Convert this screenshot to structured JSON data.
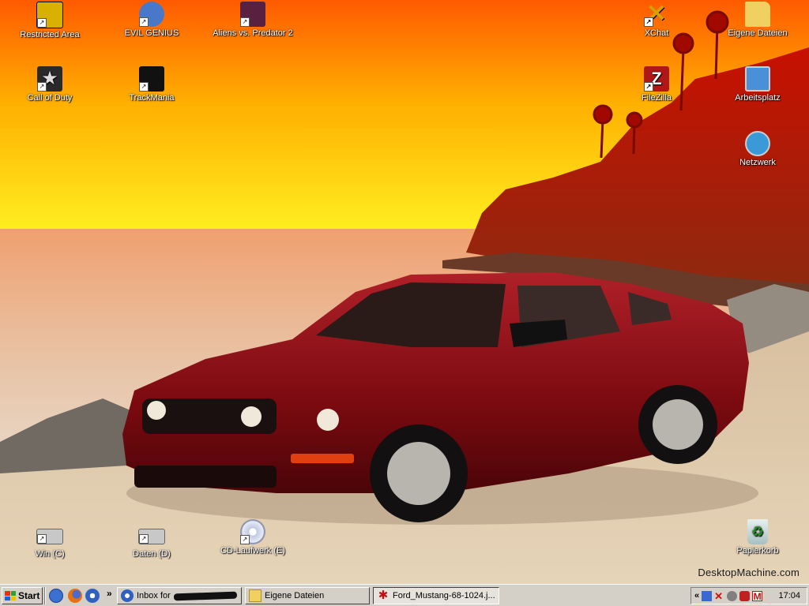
{
  "desktop": {
    "watermark": "DesktopMachine.com",
    "icons_left": [
      {
        "label": "Restricted Area",
        "icon": "restricted-area-icon",
        "color": "#d8b000"
      },
      {
        "label": "EVIL GENIUS",
        "icon": "evil-genius-icon",
        "color": "#4a78c8"
      },
      {
        "label": "Aliens vs. Predator 2",
        "icon": "avp2-icon",
        "color": "#5a2040"
      },
      {
        "label": "Call of Duty",
        "icon": "call-of-duty-icon",
        "color": "#2a2a2a"
      },
      {
        "label": "TrackMania",
        "icon": "trackmania-icon",
        "color": "#111111"
      }
    ],
    "icons_right": [
      {
        "label": "XChat",
        "icon": "xchat-icon",
        "color": "#d8a000"
      },
      {
        "label": "Eigene Dateien",
        "icon": "my-documents-icon",
        "color": "#f0d060"
      },
      {
        "label": "FileZilla",
        "icon": "filezilla-icon",
        "color": "#b01818"
      },
      {
        "label": "Arbeitsplatz",
        "icon": "my-computer-icon",
        "color": "#4a90d8"
      },
      {
        "label": "Netzwerk",
        "icon": "network-icon",
        "color": "#3a9ad8"
      }
    ],
    "icons_bottom": [
      {
        "label": "Win (C)",
        "icon": "hard-drive-icon"
      },
      {
        "label": "Daten (D)",
        "icon": "hard-drive-icon"
      },
      {
        "label": "CD-Laufwerk (E)",
        "icon": "cd-drive-icon"
      },
      {
        "label": "Papierkorb",
        "icon": "recycle-bin-icon"
      }
    ]
  },
  "taskbar": {
    "start_label": "Start",
    "quick_launch": [
      "internet-explorer-icon",
      "firefox-icon",
      "thunderbird-icon"
    ],
    "more_label": "»",
    "tasks": [
      {
        "label": "Inbox for",
        "icon": "thunderbird-icon",
        "active": false,
        "redacted": true
      },
      {
        "label": "Eigene Dateien",
        "icon": "folder-icon",
        "active": false
      },
      {
        "label": "Ford_Mustang-68-1024.j...",
        "icon": "image-viewer-icon",
        "active": true
      }
    ],
    "tray": {
      "collapse_label": "«",
      "icons": [
        "volume-icon",
        "network-disconnected-icon",
        "antivirus-icon",
        "security-icon",
        "gmail-notifier-icon"
      ],
      "clock": "17:04"
    }
  },
  "colors": {
    "sky_top": "#ff6a00",
    "sky_bottom": "#ffe000",
    "sand": "#e0cdb0",
    "car": "#8c1016",
    "taskbar": "#d4d0c8"
  }
}
